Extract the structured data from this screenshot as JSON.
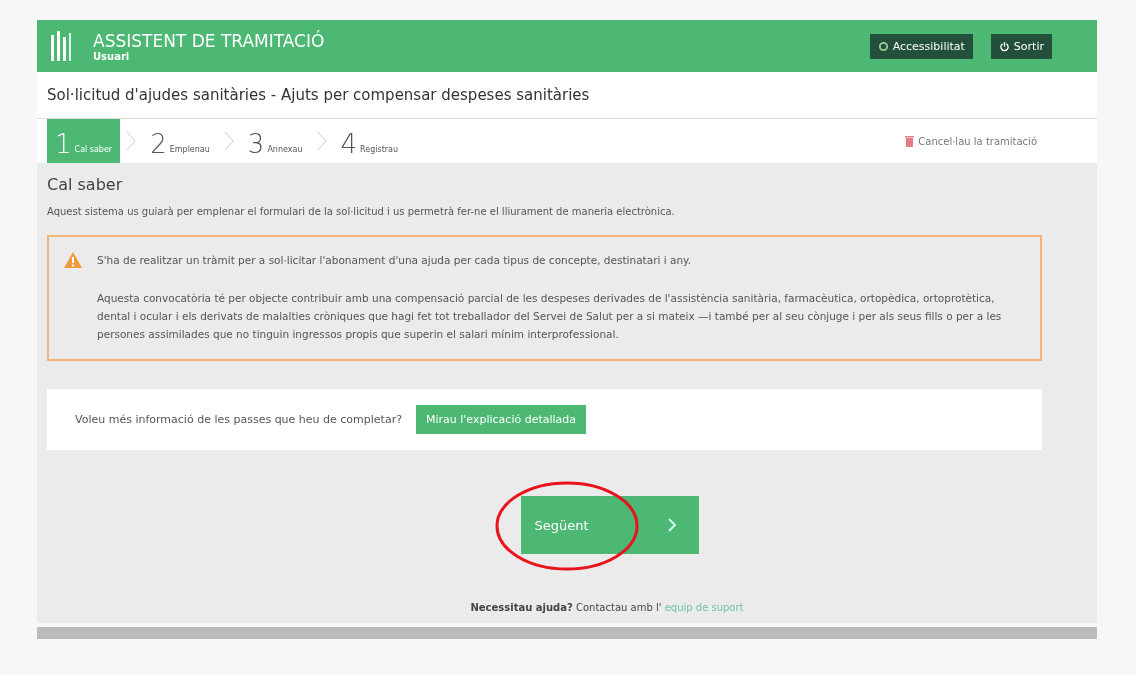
{
  "header": {
    "title": "ASSISTENT DE TRAMITACIÓ",
    "user": "Usuari",
    "buttons": [
      {
        "kind": "accessibility",
        "label": "Accessibilitat"
      },
      {
        "kind": "exit",
        "label": "Sortir"
      }
    ]
  },
  "procedure_title": "Sol·licitud d'ajudes sanitàries - Ajuts per compensar despeses sanitàries",
  "steps": [
    {
      "number": "1",
      "label": "Cal saber",
      "selected": true
    },
    {
      "number": "2",
      "label": "Emplenau",
      "selected": false
    },
    {
      "number": "3",
      "label": "Annexau",
      "selected": false
    },
    {
      "number": "4",
      "label": "Registrau",
      "selected": false
    }
  ],
  "cancel_link": "Cancel·lau la tramitació",
  "section_title": "Cal saber",
  "intro": "Aquest sistema us guiarà  per emplenar el formulari de la sol·licitud i us permetrà  fer-ne el lliurament de maneria electrònica.",
  "warning": {
    "paragraphs": [
      "S'ha de realitzar un tràmit per a sol·licitar l'abonament d'una ajuda per cada tipus de concepte,  destinatari i any.",
      "Aquesta convocatòria té per objecte contribuir amb una compensació parcial de les despeses derivades de l'assistència sanitària, farmacèutica, ortopèdica, ortoprotètica, dental i ocular i els derivats de malalties cròniques que hagi fet tot treballador del Servei de Salut per a si mateix —i també per al seu cònjuge i per als seus fills o per a les persones assimilades que no tinguin ingressos propis que superin el salari mínim interprofessional."
    ]
  },
  "info": {
    "question": "Voleu més informació de les passes que heu de completar?",
    "button": "Mirau l'explicació detallada"
  },
  "next_button": {
    "label": "Següent",
    "highlighted": true
  },
  "help": {
    "bold": "Necessitau ajuda?",
    "text": "Contactau amb l'",
    "link": "equip de suport"
  }
}
